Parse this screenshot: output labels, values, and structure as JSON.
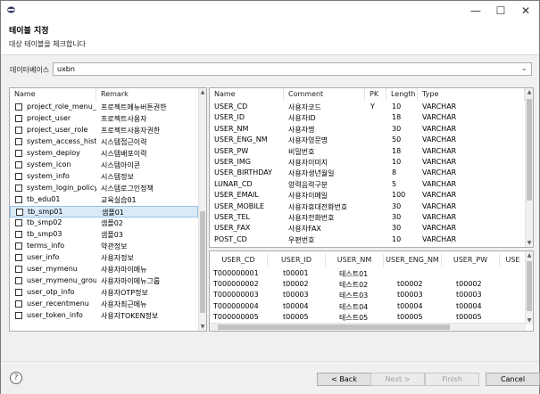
{
  "header": {
    "title": "테이블 지정",
    "subtitle": "대상 테이블을 체크합니다"
  },
  "database": {
    "label": "데이터베이스",
    "value": "uxbn"
  },
  "table_list": {
    "columns": [
      "Name",
      "Remark"
    ],
    "rows": [
      {
        "name": "project_role_menu_...",
        "remark": "프로젝트메뉴버튼권한",
        "selected": false
      },
      {
        "name": "project_user",
        "remark": "프로젝트사용자",
        "selected": false
      },
      {
        "name": "project_user_role",
        "remark": "프로젝트사용자권한",
        "selected": false
      },
      {
        "name": "system_access_history",
        "remark": "시스템접근이력",
        "selected": false
      },
      {
        "name": "system_deploy",
        "remark": "시스템배포이력",
        "selected": false
      },
      {
        "name": "system_icon",
        "remark": "시스템아이콘",
        "selected": false
      },
      {
        "name": "system_info",
        "remark": "시스템정보",
        "selected": false
      },
      {
        "name": "system_login_policy",
        "remark": "시스템로그인정책",
        "selected": false
      },
      {
        "name": "tb_edu01",
        "remark": "교육실습01",
        "selected": false
      },
      {
        "name": "tb_smp01",
        "remark": "샘플01",
        "selected": true
      },
      {
        "name": "tb_smp02",
        "remark": "샘플02",
        "selected": false
      },
      {
        "name": "tb_smp03",
        "remark": "샘플03",
        "selected": false
      },
      {
        "name": "terms_info",
        "remark": "약관정보",
        "selected": false
      },
      {
        "name": "user_info",
        "remark": "사용자정보",
        "selected": false
      },
      {
        "name": "user_mymenu",
        "remark": "사용자마이메뉴",
        "selected": false
      },
      {
        "name": "user_mymenu_group",
        "remark": "사용자마이메뉴그룹",
        "selected": false
      },
      {
        "name": "user_otp_info",
        "remark": "사용자OTP정보",
        "selected": false
      },
      {
        "name": "user_recentmenu",
        "remark": "사용자최근메뉴",
        "selected": false
      },
      {
        "name": "user_token_info",
        "remark": "사용자TOKEN정보",
        "selected": false
      }
    ]
  },
  "columns_table": {
    "headers": [
      "Name",
      "Comment",
      "PK",
      "Length",
      "Type"
    ],
    "rows": [
      [
        "USER_CD",
        "사용자코드",
        "Y",
        "10",
        "VARCHAR"
      ],
      [
        "USER_ID",
        "사용자ID",
        "",
        "18",
        "VARCHAR"
      ],
      [
        "USER_NM",
        "사용자명",
        "",
        "30",
        "VARCHAR"
      ],
      [
        "USER_ENG_NM",
        "사용자영문명",
        "",
        "50",
        "VARCHAR"
      ],
      [
        "USER_PW",
        "비밀번호",
        "",
        "18",
        "VARCHAR"
      ],
      [
        "USER_IMG",
        "사용자이미지",
        "",
        "10",
        "VARCHAR"
      ],
      [
        "USER_BIRTHDAY",
        "사용자생년월일",
        "",
        "8",
        "VARCHAR"
      ],
      [
        "LUNAR_CD",
        "양력음력구분",
        "",
        "5",
        "VARCHAR"
      ],
      [
        "USER_EMAIL",
        "사용자이메일",
        "",
        "100",
        "VARCHAR"
      ],
      [
        "USER_MOBILE",
        "사용자휴대전화번호",
        "",
        "30",
        "VARCHAR"
      ],
      [
        "USER_TEL",
        "사용자전화번호",
        "",
        "30",
        "VARCHAR"
      ],
      [
        "USER_FAX",
        "사용자FAX",
        "",
        "30",
        "VARCHAR"
      ],
      [
        "POST_CD",
        "우편번호",
        "",
        "10",
        "VARCHAR"
      ]
    ]
  },
  "data_table": {
    "headers": [
      "USER_CD",
      "USER_ID",
      "USER_NM",
      "USER_ENG_NM",
      "USER_PW",
      "USE"
    ],
    "rows": [
      [
        "T000000001",
        "t00001",
        "테스트01",
        "",
        "",
        ""
      ],
      [
        "T000000002",
        "t00002",
        "테스트02",
        "t00002",
        "t00002",
        ""
      ],
      [
        "T000000003",
        "t00003",
        "테스트03",
        "t00003",
        "t00003",
        ""
      ],
      [
        "T000000004",
        "t00004",
        "테스트04",
        "t00004",
        "t00004",
        ""
      ],
      [
        "T000000005",
        "t00005",
        "테스트05",
        "t00005",
        "t00005",
        ""
      ]
    ]
  },
  "footer": {
    "help_label": "?",
    "back_label": "< Back",
    "next_label": "Next >",
    "finish_label": "Finish",
    "cancel_label": "Cancel"
  },
  "window_controls": {
    "minimize": "—",
    "maximize": "☐",
    "close": "✕"
  }
}
